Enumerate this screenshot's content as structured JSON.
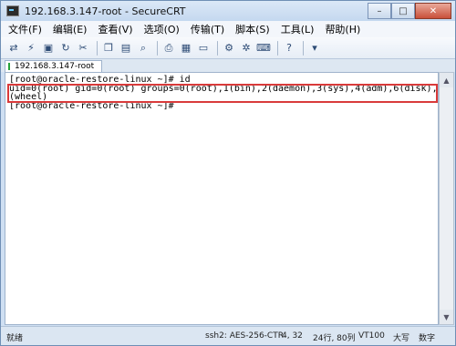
{
  "window": {
    "title": "192.168.3.147-root - SecureCRT",
    "minimize": "–",
    "maximize": "□",
    "close": "✕"
  },
  "menu": [
    "文件(F)",
    "编辑(E)",
    "查看(V)",
    "选项(O)",
    "传输(T)",
    "脚本(S)",
    "工具(L)",
    "帮助(H)"
  ],
  "tab": {
    "label": "192.168.3.147-root"
  },
  "terminal": {
    "lines": [
      "[root@oracle-restore-linux ~]# id",
      "uid=0(root) gid=0(root) groups=0(root),1(bin),2(daemon),3(sys),4(adm),6(disk),10",
      "(wheel)",
      "[root@oracle-restore-linux ~]#"
    ]
  },
  "status": {
    "ready": "就绪",
    "ssh": "ssh2: AES-256-CTR",
    "cursor": "4, 32",
    "size": "24行, 80列",
    "term": "VT100",
    "caps": "大写",
    "num": "数字"
  },
  "colors": {
    "highlight_border": "#d93a3a",
    "terminal_bg": "#ffffff"
  }
}
